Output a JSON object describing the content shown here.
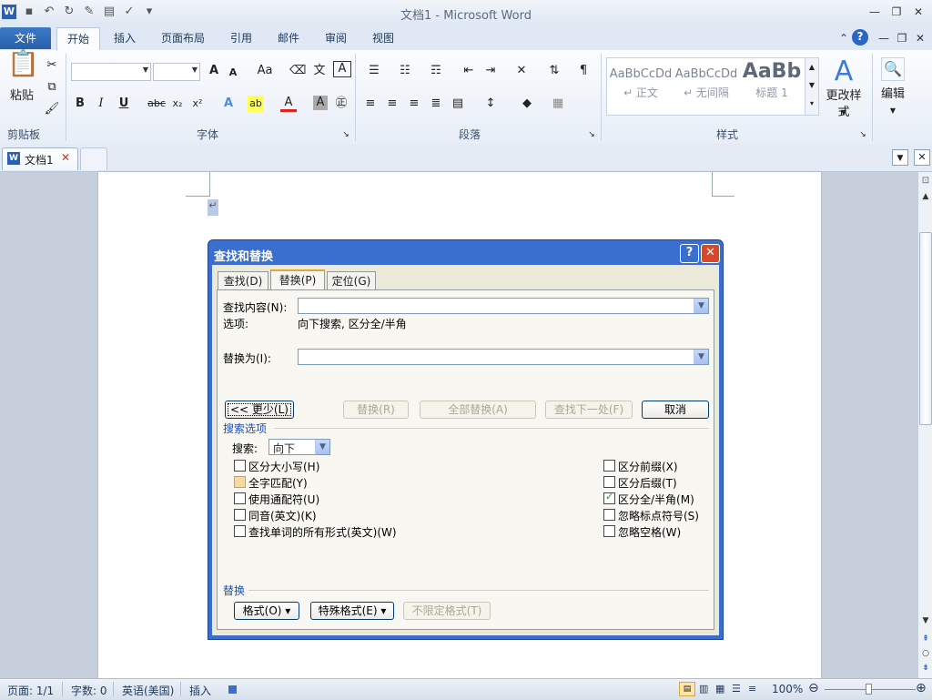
{
  "window": {
    "title": "文档1 - Microsoft Word"
  },
  "ribbon_tabs": [
    "文件",
    "开始",
    "插入",
    "页面布局",
    "引用",
    "邮件",
    "审阅",
    "视图"
  ],
  "ribbon": {
    "clipboard": {
      "paste": "粘贴",
      "group": "剪贴板"
    },
    "font": {
      "grow": "A",
      "shrink": "A",
      "case": "Aa",
      "bold": "B",
      "italic": "I",
      "underline": "U",
      "strike": "abc",
      "sub": "x₂",
      "sup": "x²",
      "text_effect": "A",
      "font_color": "A",
      "group": "字体"
    },
    "paragraph": {
      "group": "段落"
    },
    "styles": {
      "items": [
        {
          "preview": "AaBbCcDd",
          "name": "↵ 正文"
        },
        {
          "preview": "AaBbCcDd",
          "name": "↵ 无间隔"
        },
        {
          "preview": "AaBb",
          "name": "标题 1"
        }
      ],
      "change": "更改样式",
      "group": "样式"
    },
    "editing": {
      "label": "编辑"
    }
  },
  "doc_tab": {
    "label": "文档1"
  },
  "document": {
    "para_mark": "↵"
  },
  "dialog": {
    "title": "查找和替换",
    "tabs": [
      "查找(D)",
      "替换(P)",
      "定位(G)"
    ],
    "find_label": "查找内容(N):",
    "find_value": "",
    "options_label": "选项:",
    "options_value": "向下搜索, 区分全/半角",
    "replace_label": "替换为(I):",
    "replace_value": "",
    "buttons": {
      "less": "<< 更少(L)",
      "replace": "替换(R)",
      "replace_all": "全部替换(A)",
      "find_next": "查找下一处(F)",
      "cancel": "取消"
    },
    "search_options_title": "搜索选项",
    "search_label": "搜索:",
    "search_value": "向下",
    "left_options": [
      {
        "label": "区分大小写(H)",
        "checked": false
      },
      {
        "label": "全字匹配(Y)",
        "checked": false
      },
      {
        "label": "使用通配符(U)",
        "checked": false
      },
      {
        "label": "同音(英文)(K)",
        "checked": false
      },
      {
        "label": "查找单词的所有形式(英文)(W)",
        "checked": false
      }
    ],
    "right_options": [
      {
        "label": "区分前缀(X)",
        "checked": false
      },
      {
        "label": "区分后缀(T)",
        "checked": false
      },
      {
        "label": "区分全/半角(M)",
        "checked": true
      },
      {
        "label": "忽略标点符号(S)",
        "checked": false
      },
      {
        "label": "忽略空格(W)",
        "checked": false
      }
    ],
    "replace_section": "替换",
    "format_btn": "格式(O) ▾",
    "special_btn": "特殊格式(E) ▾",
    "noformat_btn": "不限定格式(T)"
  },
  "status": {
    "page": "页面: 1/1",
    "words": "字数: 0",
    "lang": "英语(美国)",
    "mode": "插入",
    "zoom": "100%"
  }
}
